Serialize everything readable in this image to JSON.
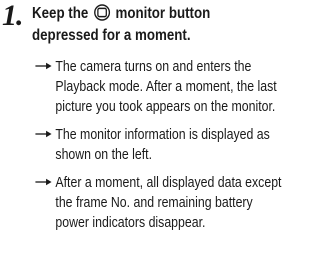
{
  "step": {
    "number": "1.",
    "heading_before_icon": "Keep the",
    "heading_icon": "monitor-button-icon",
    "heading_after_icon": "monitor button",
    "heading_line2": "depressed for a moment."
  },
  "bullets": [
    {
      "icon": "arrow-right-icon",
      "text": "The camera turns on and enters the\nPlayback mode. After a moment, the last\npicture you took appears on the monitor."
    },
    {
      "icon": "arrow-right-icon",
      "text": "The monitor information is displayed as\nshown on the left."
    },
    {
      "icon": "arrow-right-icon",
      "text": "After a moment, all displayed data except\nthe frame No. and remaining battery\npower indicators disappear."
    }
  ]
}
